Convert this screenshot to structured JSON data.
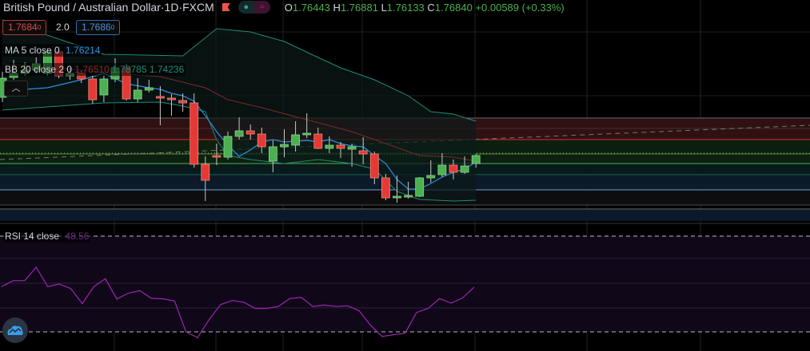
{
  "header": {
    "symbol": "British Pound / Australian Dollar",
    "sep1": " · ",
    "interval": "1D",
    "sep2": " · ",
    "exchange": "FXCM",
    "open_label": "O",
    "open": "1.76443",
    "high_label": "H",
    "high": "1.76881",
    "low_label": "L",
    "low": "1.76133",
    "close_label": "C",
    "close": "1.76840",
    "change": "+0.00589 (+0.33%)"
  },
  "trade": {
    "sell_price": "1.7684",
    "sell_sup": "0",
    "spread": "2.0",
    "buy_price": "1.7686",
    "buy_sup": "0"
  },
  "indicators": {
    "ma_label": "MA 5 close 0",
    "ma_value": "1.76214",
    "bb_label": "BB 20 close 2 0",
    "bb_basis": "1.76510",
    "bb_upper": "1.78785",
    "bb_lower": "1.74236",
    "rsi_label": "RSI 14 close",
    "rsi_value": "48.56"
  },
  "collapse_icon": "chevron-up",
  "colors": {
    "up": "#4caf50",
    "down": "#e53935",
    "ma": "#2f8fde",
    "bb_band": "#1f8a7a",
    "bb_basis": "#7a2a2a",
    "rsi": "#9c27b0"
  },
  "chart_data": {
    "type": "candlestick",
    "ohlc": [
      [
        1.8051,
        1.8211,
        1.8021,
        1.8171
      ],
      [
        1.8176,
        1.8286,
        1.8161,
        1.8201
      ],
      [
        1.8201,
        1.8271,
        1.8186,
        1.8221
      ],
      [
        1.8221,
        1.8301,
        1.8201,
        1.8261
      ],
      [
        1.8201,
        1.8361,
        1.8186,
        1.8336
      ],
      [
        1.8336,
        1.8351,
        1.8171,
        1.8186
      ],
      [
        1.8186,
        1.8236,
        1.8161,
        1.8201
      ],
      [
        1.8201,
        1.8221,
        1.8141,
        1.8166
      ],
      [
        1.8166,
        1.8186,
        1.8011,
        1.8036
      ],
      [
        1.8066,
        1.8186,
        1.8021,
        1.8166
      ],
      [
        1.8166,
        1.8296,
        1.8146,
        1.8236
      ],
      [
        1.8236,
        1.8261,
        1.8031,
        1.8041
      ],
      [
        1.8041,
        1.8171,
        1.8021,
        1.8096
      ],
      [
        1.8096,
        1.8161,
        1.8081,
        1.8111
      ],
      [
        1.8056,
        1.8121,
        1.7876,
        1.8046
      ],
      [
        1.8046,
        1.8071,
        1.7936,
        1.8036
      ],
      [
        1.8031,
        1.8076,
        1.7961,
        1.8016
      ],
      [
        1.8016,
        1.8076,
        1.7611,
        1.7631
      ],
      [
        1.7631,
        1.7681,
        1.7401,
        1.7531
      ],
      [
        1.7686,
        1.7761,
        1.7626,
        1.7676
      ],
      [
        1.7676,
        1.7836,
        1.7661,
        1.7806
      ],
      [
        1.7806,
        1.7926,
        1.7786,
        1.7841
      ],
      [
        1.7841,
        1.7881,
        1.7786,
        1.7821
      ],
      [
        1.7821,
        1.7861,
        1.7701,
        1.7741
      ],
      [
        1.7651,
        1.7781,
        1.7581,
        1.7741
      ],
      [
        1.7741,
        1.7851,
        1.7676,
        1.7756
      ],
      [
        1.7751,
        1.7901,
        1.7711,
        1.7816
      ],
      [
        1.7816,
        1.7951,
        1.7796,
        1.7826
      ],
      [
        1.7821,
        1.7861,
        1.7726,
        1.7731
      ],
      [
        1.7731,
        1.7806,
        1.7701,
        1.7751
      ],
      [
        1.7751,
        1.7771,
        1.7671,
        1.7731
      ],
      [
        1.7726,
        1.7761,
        1.7616,
        1.7741
      ],
      [
        1.7716,
        1.7801,
        1.7631,
        1.7696
      ],
      [
        1.7696,
        1.7711,
        1.7506,
        1.7546
      ],
      [
        1.7546,
        1.7571,
        1.7406,
        1.7421
      ],
      [
        1.7421,
        1.7561,
        1.7391,
        1.7431
      ],
      [
        1.7426,
        1.7521,
        1.7416,
        1.7436
      ],
      [
        1.7431,
        1.7551,
        1.7426,
        1.7546
      ],
      [
        1.7546,
        1.7656,
        1.7516,
        1.7561
      ],
      [
        1.7566,
        1.7701,
        1.7551,
        1.7626
      ],
      [
        1.7626,
        1.7661,
        1.7536,
        1.7581
      ],
      [
        1.7581,
        1.7681,
        1.7571,
        1.7621
      ],
      [
        1.7636,
        1.7696,
        1.7611,
        1.7686
      ]
    ],
    "bb_upper": [
      [
        0,
        1.8536
      ],
      [
        9,
        1.8321
      ],
      [
        16,
        1.8311
      ],
      [
        19,
        1.8481
      ],
      [
        22,
        1.8461
      ],
      [
        25,
        1.8401
      ],
      [
        28,
        1.8301
      ],
      [
        30,
        1.8236
      ],
      [
        33,
        1.8161
      ],
      [
        36,
        1.8061
      ],
      [
        38,
        1.7961
      ],
      [
        40,
        1.7946
      ],
      [
        42,
        1.7901
      ]
    ],
    "bb_lower": [
      [
        0,
        1.7971
      ],
      [
        9,
        1.8016
      ],
      [
        14,
        1.8021
      ],
      [
        16,
        1.7996
      ],
      [
        18,
        1.7961
      ],
      [
        19,
        1.7786
      ],
      [
        20,
        1.7686
      ],
      [
        22,
        1.7661
      ],
      [
        25,
        1.7636
      ],
      [
        28,
        1.7661
      ],
      [
        31,
        1.7636
      ],
      [
        33,
        1.7601
      ],
      [
        35,
        1.7461
      ],
      [
        37,
        1.7411
      ],
      [
        40,
        1.7401
      ],
      [
        42,
        1.7406
      ]
    ],
    "bb_basis": [
      [
        0,
        1.8261
      ],
      [
        7,
        1.8221
      ],
      [
        10,
        1.8201
      ],
      [
        14,
        1.8181
      ],
      [
        18,
        1.8111
      ],
      [
        20,
        1.8036
      ],
      [
        23,
        1.7986
      ],
      [
        27,
        1.7911
      ],
      [
        31,
        1.7836
      ],
      [
        34,
        1.7761
      ],
      [
        37,
        1.7686
      ],
      [
        40,
        1.7676
      ],
      [
        42,
        1.7651
      ]
    ],
    "ma5": [
      [
        0,
        1.8091
      ],
      [
        4,
        1.8111
      ],
      [
        7,
        1.8161
      ],
      [
        9,
        1.8201
      ],
      [
        11,
        1.8136
      ],
      [
        13,
        1.8111
      ],
      [
        14,
        1.8101
      ],
      [
        15,
        1.8076
      ],
      [
        16,
        1.8061
      ],
      [
        17,
        1.8026
      ],
      [
        18,
        1.7936
      ],
      [
        19,
        1.7836
      ],
      [
        20,
        1.7751
      ],
      [
        21,
        1.7681
      ],
      [
        22,
        1.7721
      ],
      [
        23,
        1.7771
      ],
      [
        24,
        1.7786
      ],
      [
        25,
        1.7771
      ],
      [
        26,
        1.7776
      ],
      [
        27,
        1.7781
      ],
      [
        28,
        1.7771
      ],
      [
        29,
        1.7786
      ],
      [
        30,
        1.7761
      ],
      [
        31,
        1.7746
      ],
      [
        32,
        1.7741
      ],
      [
        33,
        1.7686
      ],
      [
        34,
        1.7636
      ],
      [
        35,
        1.7536
      ],
      [
        36,
        1.7476
      ],
      [
        37,
        1.7476
      ],
      [
        38,
        1.7511
      ],
      [
        39,
        1.7551
      ],
      [
        40,
        1.7581
      ],
      [
        41,
        1.7601
      ],
      [
        42,
        1.7646
      ]
    ],
    "rsi": [
      48.9,
      51.4,
      51.4,
      57.0,
      48.9,
      50.0,
      48.1,
      41.8,
      48.9,
      52.2,
      43.7,
      46.2,
      47.2,
      44.0,
      43.8,
      42.9,
      30.0,
      27.6,
      35.1,
      41.4,
      43.1,
      42.4,
      39.8,
      39.8,
      40.6,
      43.9,
      44.4,
      40.6,
      41.2,
      40.6,
      40.9,
      38.9,
      32.8,
      28.1,
      28.8,
      29.4,
      38.1,
      39.8,
      43.9,
      42.0,
      44.2,
      48.7
    ],
    "rsi_levels": [
      70,
      30
    ]
  }
}
